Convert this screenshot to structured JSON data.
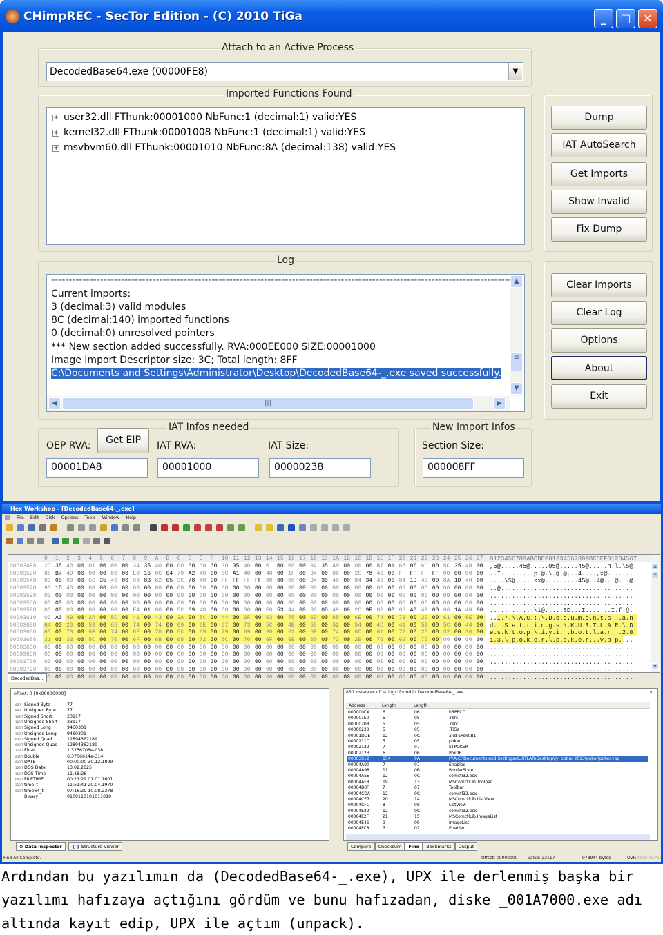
{
  "imprec": {
    "title": "CHimpREC - SecTor Edition - (C) 2010 TiGa",
    "window_buttons": [
      "_",
      "□",
      "✕"
    ],
    "attach_group": "Attach to an Active Process",
    "process": "DecodedBase64.exe (00000FE8)",
    "imports_group": "Imported Functions Found",
    "imports": [
      "user32.dll FThunk:00001000 NbFunc:1 (decimal:1) valid:YES",
      "kernel32.dll FThunk:00001008 NbFunc:1 (decimal:1) valid:YES",
      "msvbvm60.dll FThunk:00001010 NbFunc:8A (decimal:138) valid:YES"
    ],
    "buttons_top": [
      "Dump",
      "IAT AutoSearch",
      "Get Imports",
      "Show Invalid",
      "Fix Dump"
    ],
    "log_group": "Log",
    "log": [
      "------------------------------------------------------------------------------------------------------------------------------------",
      "Current imports:",
      "3 (decimal:3) valid modules",
      "8C (decimal:140) imported functions",
      "0 (decimal:0) unresolved pointers",
      "*** New section added successfully. RVA:000EE000 SIZE:00001000",
      "Image Import Descriptor size: 3C; Total length: 8FF",
      "C:\\Documents and Settings\\Administrator\\Desktop\\DecodedBase64-_.exe saved successfully."
    ],
    "buttons_bottom": [
      "Clear Imports",
      "Clear Log",
      "Options",
      "About",
      "Exit"
    ],
    "iat_group": "IAT Infos needed",
    "oep_label": "OEP RVA:",
    "get_eip": "Get EIP",
    "iat_rva_label": "IAT RVA:",
    "iat_size_label": "IAT Size:",
    "oep_value": "00001DA8",
    "iat_rva_value": "00001000",
    "iat_size_value": "00000238",
    "new_group": "New Import Infos",
    "section_size_label": "Section Size:",
    "section_size_value": "000008FF"
  },
  "hexworkshop": {
    "title": "Hex Workshop - [DecodedBase64-_.exe]",
    "menu": [
      "File",
      "Edit",
      "Disk",
      "Options",
      "Tools",
      "Window",
      "Help"
    ],
    "column_header": [
      "0",
      "1",
      "2",
      "3",
      "4",
      "5",
      "6",
      "7",
      "8",
      "9",
      "A",
      "B",
      "C",
      "D",
      "E",
      "F",
      "10",
      "11",
      "12",
      "13",
      "14",
      "15",
      "16",
      "17",
      "18",
      "19",
      "1A",
      "1B",
      "1C",
      "1D",
      "1E",
      "1F",
      "20",
      "21",
      "22",
      "23",
      "24",
      "25",
      "26",
      "27"
    ],
    "ascii_header": "0123456789ABCDEF0123456789ABCDEF01234567",
    "highlight": {
      "start_offset": "00003612",
      "length_bytes": 154
    },
    "rows": [
      {
        "offset": "000034F8",
        "hex": "2C 35 40 00 01 00 00 00 34 35 40 00 00 00 00 00 30 35 40 00 01 00 00 00 34 35 40 00 00 00 B7 01 68 00 6C 00 5C 35 40 00",
        "ascii": ",5@.....45@.....05@.....45@.....h.l.\\5@."
      },
      {
        "offset": "00003520",
        "hex": "88 B7 49 00 00 00 00 00 E0 16 0C 04 70 A2 40 00 5C A1 40 00 40 00 1F 00 34 00 00 00 2C 78 40 00 FF FF FF FF 00 00 00 00",
        "ascii": "..I.........p.@.\\.@.@...4....,x@........"
      },
      {
        "offset": "00003548",
        "hex": "00 00 00 00 5C 35 40 00 98 8B 82 05 3C 78 40 00 FF FF FF FF 00 00 00 00 34 35 40 00 84 34 40 00 84 1D 40 00 8A 1D 40 00",
        "ascii": "....\\5@.....<x@.........45@..4@...@...@."
      },
      {
        "offset": "00003570",
        "hex": "90 1D 40 00 00 00 00 00 00 00 00 00 00 00 00 00 00 00 00 00 00 00 00 00 00 00 00 00 00 00 00 00 00 00 00 00 00 00 00 00",
        "ascii": "..@....................................."
      },
      {
        "offset": "00003598",
        "hex": "00 00 00 00 00 00 00 00 00 00 00 00 00 00 00 00 00 00 00 00 00 00 00 00 00 00 00 00 00 00 00 00 00 00 00 00 00 00 00 00",
        "ascii": "........................................"
      },
      {
        "offset": "000035C0",
        "hex": "00 00 00 00 00 00 00 00 00 00 00 00 00 00 00 00 00 00 00 00 00 00 00 00 00 00 00 00 00 00 00 00 00 00 00 00 00 00 00 00",
        "ascii": "........................................"
      },
      {
        "offset": "000035E8",
        "hex": "00 00 00 00 00 00 00 00 F4 01 00 00 5C 69 40 00 00 00 00 00 E0 53 44 00 80 0D 49 00 2C 9E 00 00 08 A0 49 00 66 1A 40 00",
        "ascii": "............\\i@.....SD...I.......I.f.@."
      },
      {
        "offset": "00003610",
        "hex": "00 A0 49 00 2A 00 5C 00 41 00 43 00 3A 00 5C 00 44 00 6F 00 63 00 75 00 6D 00 65 00 6E 00 74 00 73 00 20 00 61 00 6E 00",
        "ascii": "..I.*.\\.A.C.:.\\.D.o.c.u.m.e.n.t.s. .a.n."
      },
      {
        "offset": "00003638",
        "hex": "64 00 20 00 53 00 65 00 74 00 74 00 69 00 6E 00 67 00 73 00 5C 00 4B 00 55 00 52 00 54 00 4C 00 41 00 52 00 5C 00 44 00",
        "ascii": "d. .S.e.t.t.i.n.g.s.\\.K.U.R.T.L.A.R.\\.D."
      },
      {
        "offset": "00003660",
        "hex": "65 00 73 00 6B 00 74 00 6F 00 70 00 5C 00 69 00 79 00 69 00 20 00 62 00 6F 00 74 00 6C 00 61 00 72 00 20 00 32 00 30 00",
        "ascii": "e.s.k.t.o.p.\\.i.y.i. .b.o.t.l.a.r. .2.0."
      },
      {
        "offset": "00003688",
        "hex": "31 00 33 00 5C 00 70 00 6F 00 6B 00 65 00 72 00 5C 00 70 00 6F 00 6B 00 65 00 72 00 2E 00 76 00 62 00 70 00 00 00 00 00",
        "ascii": "1.3.\\.p.o.k.e.r.\\.p.o.k.e.r...v.b.p...."
      },
      {
        "offset": "000036B0",
        "hex": "00 00 00 00 00 00 00 00 00 00 00 00 00 00 00 00 00 00 00 00 00 00 00 00 00 00 00 00 00 00 00 00 00 00 00 00 00 00 00 00",
        "ascii": "........................................"
      },
      {
        "offset": "000036D8",
        "hex": "00 00 00 00 00 00 00 00 00 00 00 00 00 00 00 00 00 00 00 00 00 00 00 00 00 00 00 00 00 00 00 00 00 00 00 00 00 00 00 00",
        "ascii": "........................................"
      },
      {
        "offset": "00003700",
        "hex": "00 00 00 00 00 00 00 00 00 00 00 00 00 00 00 00 00 00 00 00 00 00 00 00 00 00 00 00 00 00 00 00 00 00 00 00 00 00 00 00",
        "ascii": "........................................"
      },
      {
        "offset": "00003728",
        "hex": "00 00 00 00 00 00 00 00 00 00 00 00 00 00 00 00 00 00 00 00 00 00 00 00 00 00 00 00 00 00 00 00 00 00 00 00 00 00 00 00",
        "ascii": "........................................"
      },
      {
        "offset": "00003750",
        "hex": "00 00 00 00 00 00 00 00 00 00 00 00 00 00 00 00 00 00 00 00 00 00 00 00 00 00 00 00 00 00 00 00 00 00 00 00 00 00 00 00",
        "ascii": "........................................"
      }
    ],
    "doc_tab": "DecodedBas...",
    "inspector": {
      "offset": "offset: 0 [0x00000000]",
      "rows": [
        {
          "bits": "8BIT",
          "name": "Signed Byte",
          "value": "77"
        },
        {
          "bits": "8BIT",
          "name": "Unsigned Byte",
          "value": "77"
        },
        {
          "bits": "16BIT",
          "name": "Signed Short",
          "value": "23117"
        },
        {
          "bits": "16BIT",
          "name": "Unsigned Short",
          "value": "23117"
        },
        {
          "bits": "32BIT",
          "name": "Signed Long",
          "value": "9460301"
        },
        {
          "bits": "32BIT",
          "name": "Unsigned Long",
          "value": "9460301"
        },
        {
          "bits": "64BIT",
          "name": "Signed Quad",
          "value": "12894362189"
        },
        {
          "bits": "64BIT",
          "name": "Unsigned Quad",
          "value": "12894362189"
        },
        {
          "bits": "32BIT",
          "name": "Float",
          "value": "1.3256706e-038"
        },
        {
          "bits": "64BIT",
          "name": "Double",
          "value": "6.3706614e-314"
        },
        {
          "bits": "64BIT",
          "name": "DATE",
          "value": "00:00:00 30.12.1899"
        },
        {
          "bits": "16BIT",
          "name": "DOS Date",
          "value": "13.02.2025"
        },
        {
          "bits": "16BIT",
          "name": "DOS Time",
          "value": "11:18:26"
        },
        {
          "bits": "64BIT",
          "name": "FILETIME",
          "value": "00:21:29 01.01.1601"
        },
        {
          "bits": "32BIT",
          "name": "time_t",
          "value": "11:51:41 20.04.1970"
        },
        {
          "bits": "64BIT",
          "name": "time64_t",
          "value": "07:16:29 10.08.2378"
        },
        {
          "bits": "",
          "name": "Binary",
          "value": "0100110101011010"
        }
      ],
      "tabs": [
        "Data Inspector",
        "Structure Viewer"
      ]
    },
    "find": {
      "summary": "830 instances of 'strings' found in DecodedBase64-_.exe",
      "columns": [
        "Address",
        "Length",
        "Length"
      ],
      "rows": [
        [
          "000000CA",
          "6",
          "06",
          "hRPECO"
        ],
        [
          "000001E0",
          "5",
          "05",
          ".rsrc"
        ],
        [
          "00000208",
          "5",
          "05",
          ".rsrc"
        ],
        [
          "00000230",
          "5",
          "05",
          ".TiGa"
        ],
        [
          "00001DDE",
          "12",
          "0C",
          " and SPok0B1"
        ],
        [
          "0000211C",
          "5",
          "05",
          "poker"
        ],
        [
          "00002122",
          "7",
          "07",
          "STPOKER"
        ],
        [
          "0000212B",
          "6",
          "06",
          "Pok0B1"
        ],
        [
          "00003612",
          "154",
          "9A",
          "I*\\A\\C:\\Documents and Settings\\KURTLAR\\Desktop\\iyi botlar 2013\\poker\\poker.vbp"
        ],
        [
          "00004A90",
          "7",
          "07",
          "Enabled"
        ],
        [
          "00004A98",
          "11",
          "0B",
          "BorderStyle"
        ],
        [
          "00004AEE",
          "12",
          "0C",
          "comctl32.ocx"
        ],
        [
          "00004AF8",
          "19",
          "13",
          "MSComctlLib.Toolbar"
        ],
        [
          "00004B0F",
          "7",
          "07",
          "Toolbar"
        ],
        [
          "00004CDA",
          "12",
          "0C",
          "comctl32.ocx"
        ],
        [
          "00004CE7",
          "20",
          "14",
          "MSComctlLib.ListView"
        ],
        [
          "00004CFC",
          "8",
          "08",
          "ListView"
        ],
        [
          "00004E22",
          "12",
          "0C",
          "comctl32.ocx"
        ],
        [
          "00004E2F",
          "21",
          "15",
          "MSComctlLib.ImageList"
        ],
        [
          "00004E45",
          "9",
          "09",
          "ImageList"
        ],
        [
          "00004FC8",
          "7",
          "07",
          "Enabled"
        ]
      ],
      "selected_index": 8,
      "tabs": [
        "Compare",
        "Checksum",
        "Find",
        "Bookmarks",
        "Output"
      ]
    },
    "status": {
      "message": "Find All Complete.",
      "offset": "Offset: 00000000",
      "value": "Value: 23117",
      "size": "978944 bytes",
      "modes": [
        "OVR",
        "MOD",
        "READ"
      ]
    }
  },
  "caption": [
    "Ardından bu yazılımın da (DecodedBase64-_.exe), UPX ile derlenmiş başka bir",
    "yazılımı hafızaya açtığını gördüm ve bunu hafızadan, diske _001A7000.exe adı",
    "altında kayıt edip, UPX ile açtım (unpack)."
  ],
  "colors": {
    "xp_blue": "#0a4fd8",
    "selection": "#316ac5",
    "hex_highlight": "#fbf57a",
    "window_bg": "#ece9d8"
  }
}
